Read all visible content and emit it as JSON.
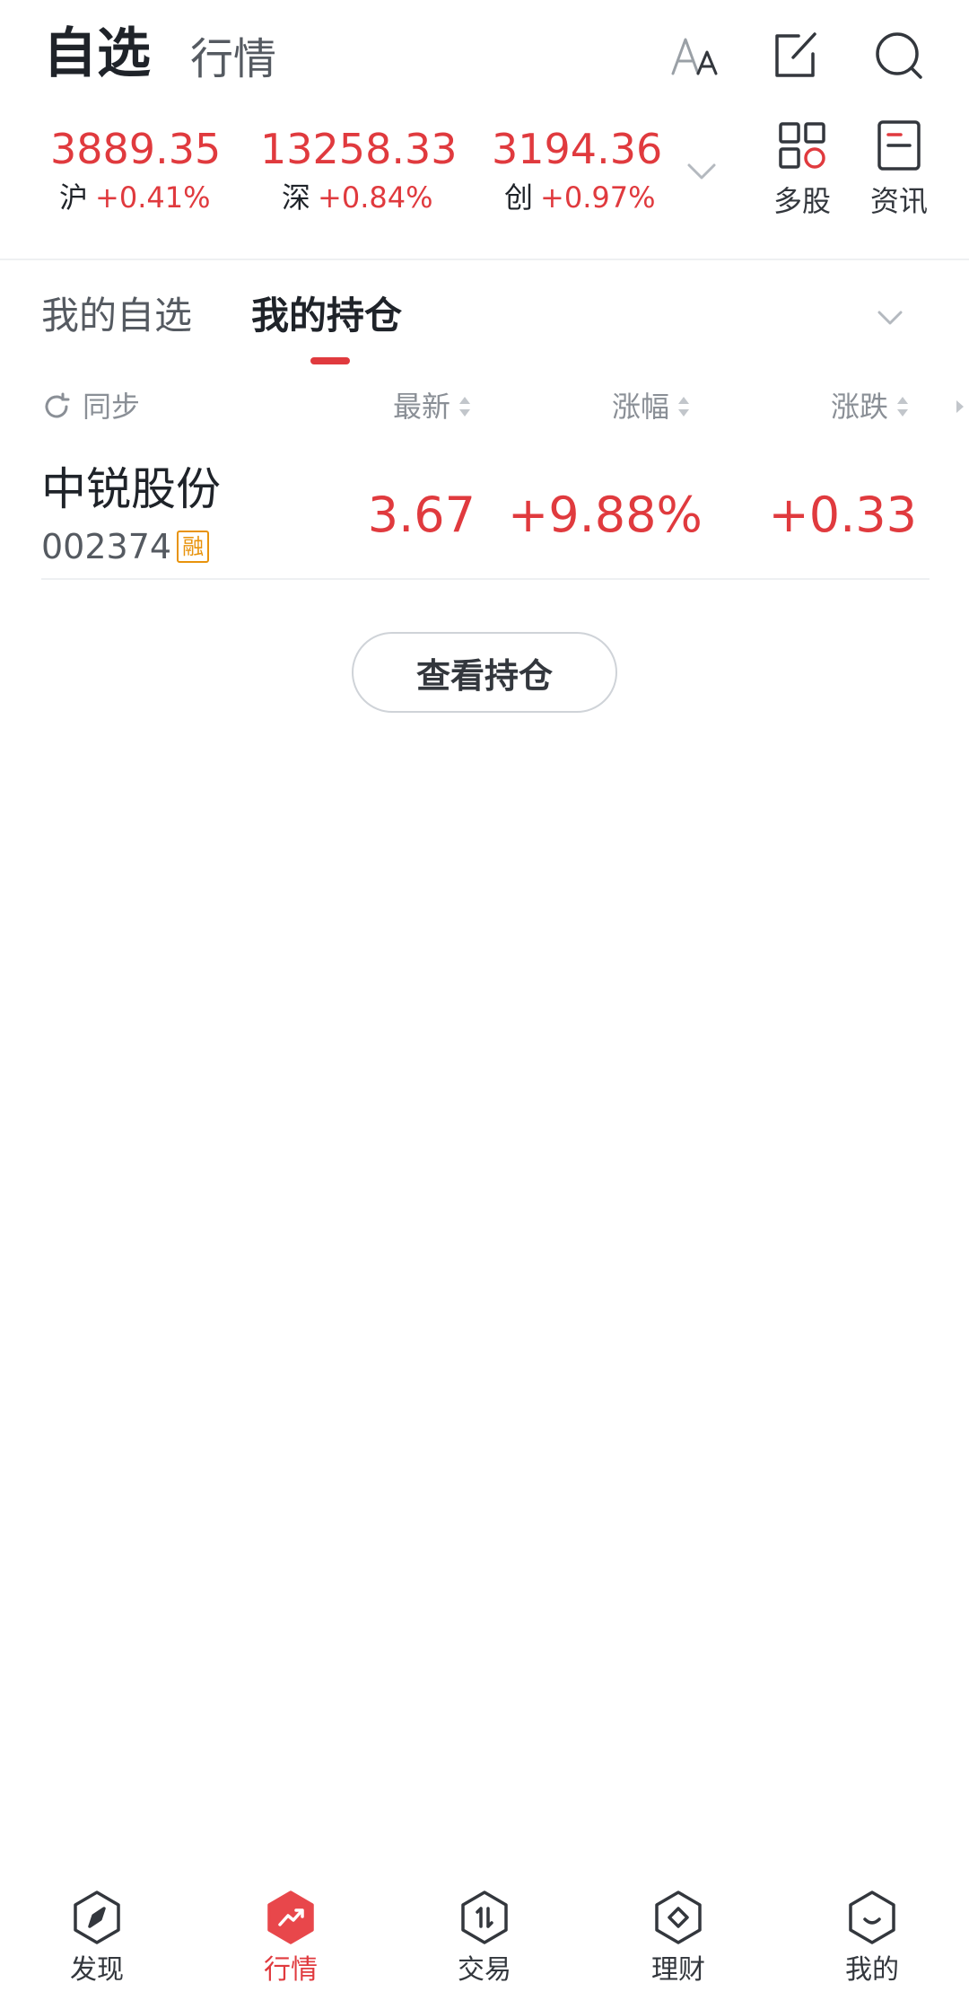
{
  "header": {
    "title_main": "自选",
    "title_sub": "行情",
    "icons": [
      "font-size-icon",
      "edit-icon",
      "search-icon"
    ]
  },
  "indices": [
    {
      "value": "3889.35",
      "name": "沪",
      "change": "+0.41%"
    },
    {
      "value": "13258.33",
      "name": "深",
      "change": "+0.84%"
    },
    {
      "value": "3194.36",
      "name": "创",
      "change": "+0.97%"
    }
  ],
  "tools": {
    "multi_stock": "多股",
    "news": "资讯"
  },
  "tabs": [
    {
      "label": "我的自选",
      "active": false
    },
    {
      "label": "我的持仓",
      "active": true
    }
  ],
  "table": {
    "sync_label": "同步",
    "columns": [
      "最新",
      "涨幅",
      "涨跌"
    ],
    "rows": [
      {
        "name": "中锐股份",
        "code": "002374",
        "badge": "融",
        "latest": "3.67",
        "pct": "+9.88%",
        "change": "+0.33"
      }
    ]
  },
  "view_holdings_button": "查看持仓",
  "bottom_nav": [
    {
      "label": "发现",
      "icon": "compass-icon",
      "active": false
    },
    {
      "label": "行情",
      "icon": "market-icon",
      "active": true
    },
    {
      "label": "交易",
      "icon": "trade-icon",
      "active": false
    },
    {
      "label": "理财",
      "icon": "finance-icon",
      "active": false
    },
    {
      "label": "我的",
      "icon": "profile-icon",
      "active": false
    }
  ],
  "colors": {
    "accent_red": "#e03a3e",
    "text_primary": "#1f2329",
    "text_secondary": "#555a61",
    "badge_orange": "#e8930c"
  }
}
